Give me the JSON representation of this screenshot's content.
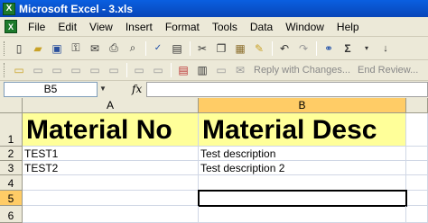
{
  "window": {
    "title": "Microsoft Excel - 3.xls"
  },
  "menu": [
    "File",
    "Edit",
    "View",
    "Insert",
    "Format",
    "Tools",
    "Data",
    "Window",
    "Help"
  ],
  "toolbar2": {
    "reply_label": "Reply with Changes...",
    "end_review_label": "End Review..."
  },
  "formula_bar": {
    "name_box": "B5",
    "fx": "fx",
    "value": ""
  },
  "columns": [
    "A",
    "B"
  ],
  "rows": [
    "1",
    "2",
    "3",
    "4",
    "5",
    "6"
  ],
  "cells": {
    "A1": "Material No",
    "B1": "Material Desc",
    "A2": "TEST1",
    "B2": "Test description",
    "A3": "TEST2",
    "B3": "Test description 2",
    "A4": "",
    "B4": "",
    "A5": "",
    "B5": "",
    "A6": "",
    "B6": ""
  },
  "active_cell": "B5",
  "colors": {
    "header_fill": "#ffff99",
    "selected_header": "#ffcc66",
    "title_bar": "#0a5fe0"
  }
}
